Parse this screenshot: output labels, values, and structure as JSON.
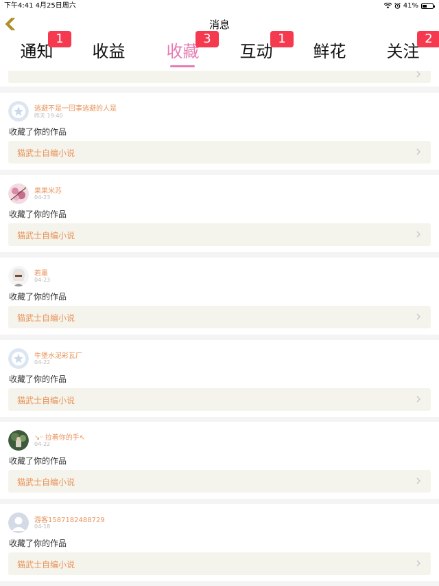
{
  "status_bar": {
    "time_date": "下午4:41   4月25日周六",
    "battery": "41%",
    "battery_level": 0.41
  },
  "header": {
    "title": "消息"
  },
  "tabs": [
    {
      "label": "通知",
      "badge": "1"
    },
    {
      "label": "收益",
      "badge": ""
    },
    {
      "label": "收藏",
      "badge": "3",
      "active": true
    },
    {
      "label": "互动",
      "badge": "1"
    },
    {
      "label": "鲜花",
      "badge": ""
    },
    {
      "label": "关注",
      "badge": "2"
    }
  ],
  "items": [
    {
      "name": "逃避不是一回事逃避的人是",
      "time": "昨天 19:40",
      "action": "收藏了你的作品",
      "work": "猫武士自编小说",
      "avatar": "default-star-avatar"
    },
    {
      "name": "果果米苏",
      "time": "04-23",
      "action": "收藏了你的作品",
      "work": "猫武士自编小说",
      "avatar": "pink-flower-avatar"
    },
    {
      "name": "若墨",
      "time": "04-23",
      "action": "收藏了你的作品",
      "work": "猫武士自编小说",
      "avatar": "white-hair-character-avatar"
    },
    {
      "name": "牛堡水泥彩瓦厂",
      "time": "04-22",
      "action": "收藏了你的作品",
      "work": "猫武士自编小说",
      "avatar": "default-star-avatar"
    },
    {
      "name": "↘ᵕ 拉着你的手↖",
      "time": "04-22",
      "action": "收藏了你的作品",
      "work": "猫武士自编小说",
      "avatar": "green-photo-avatar"
    },
    {
      "name": "游客1587182488729",
      "time": "04-18",
      "action": "收藏了你的作品",
      "work": "猫武士自编小说",
      "avatar": "guest-person-avatar"
    }
  ],
  "colors": {
    "accent": "#e87ab2",
    "badge": "#f53a4f",
    "username": "#e8935a",
    "work_bg": "#f5f4ec"
  }
}
